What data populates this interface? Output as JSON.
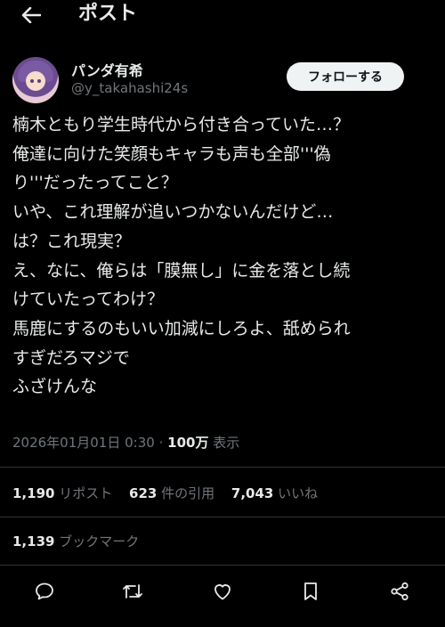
{
  "header": {
    "title": "ポスト",
    "back_icon": "arrow-left-icon"
  },
  "author": {
    "name": "パンダ有希",
    "handle": "@y_takahashi24s",
    "follow_label": "フォローする"
  },
  "post": {
    "lines": [
      "楠木ともり学生時代から付き合っていた…？",
      "俺達に向けた笑顔もキャラも声も全部'''偽",
      "り'''だったってこと？",
      "いや、これ理解が追いつかないんだけど…",
      "は？これ現実？",
      "え、なに、俺らは「膜無し」に金を落とし続",
      "けていたってわけ？",
      "馬鹿にするのもいい加減にしろよ、舐められ",
      "すぎだろマジで",
      "ふざけんな"
    ],
    "timestamp": "2026年01月01日 0:30",
    "views_count": "100万",
    "views_label": "表示"
  },
  "stats": {
    "reposts": {
      "count": "1,190",
      "label": "リポスト"
    },
    "quotes": {
      "count": "623",
      "label": "件の引用"
    },
    "likes": {
      "count": "7,043",
      "label": "いいね"
    },
    "bookmarks": {
      "count": "1,139",
      "label": "ブックマーク"
    }
  },
  "actions": [
    "reply-icon",
    "repost-icon",
    "like-icon",
    "bookmark-icon",
    "share-icon"
  ],
  "colors": {
    "background": "#000000",
    "text": "#e7e9ea",
    "secondary": "#71767b",
    "divider": "#2f3336",
    "follow_bg": "#eff3f4"
  }
}
